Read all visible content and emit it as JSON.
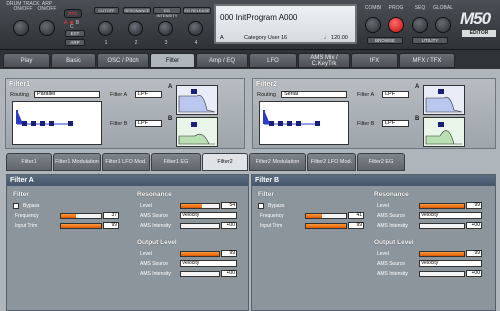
{
  "top": {
    "drum_track_label": "DRUM TRACK ON/OFF",
    "arp_label": "ARP ON/OFF",
    "rtc_label": "RTC",
    "abc_labels": [
      "A",
      "B",
      "C"
    ],
    "ext_label": "EXT",
    "arp_btn_label": "ARP",
    "knob_labels": [
      "CUTOFF",
      "RESONANCE",
      "EG INTENSITY",
      "EG RELEASE"
    ],
    "knob_numbers": [
      "1",
      "2",
      "3",
      "4"
    ],
    "combi_label": "COMBI",
    "prog_label": "PROG",
    "seq_label": "SEQ",
    "global_label": "GLOBAL",
    "browse_label": "BROWSE",
    "utility_label": "UTILITY",
    "logo": "M50",
    "logo_sub": "EDITOR"
  },
  "lcd": {
    "program": "000 InitProgram A000",
    "bank": "A",
    "category": "Category User 16",
    "tempo": "♩ 120.00"
  },
  "tabs": [
    "Play",
    "Basic",
    "OSC / Pitch",
    "Filter",
    "Amp / EQ",
    "LFO",
    "AMS Mix / C.KeyTrk",
    "IFX",
    "MFX / TFX"
  ],
  "active_tab": "Filter",
  "filter1": {
    "title": "Filter1",
    "routing_label": "Routing",
    "routing_value": "Parallel",
    "a_label": "Filter A",
    "a_type": "LPF",
    "b_label": "Filter B",
    "b_type": "LPF"
  },
  "filter2": {
    "title": "Filter2",
    "routing_label": "Routing",
    "routing_value": "Serial",
    "a_label": "Filter A",
    "a_type": "LPF",
    "b_label": "Filter B",
    "b_type": "LPF"
  },
  "subtabs": [
    "Filter1",
    "Filter1 Modulation",
    "Filter1 LFO Mod.",
    "Filter1 EG",
    "Filter2",
    "Filter2 Modulation",
    "Filter2 LFO Mod.",
    "Filter2 EG"
  ],
  "active_subtab": "Filter2",
  "filterA": {
    "title": "Filter A",
    "filter_label": "Filter",
    "bypass_label": "Bypass",
    "frequency_label": "Frequency",
    "frequency_value": "37",
    "frequency_frac": 0.37,
    "input_trim_label": "Input Trim",
    "input_trim_value": "99",
    "input_trim_frac": 0.99,
    "resonance_label": "Resonance",
    "res_level_label": "Level",
    "res_level_value": "54",
    "res_level_frac": 0.54,
    "res_ams_label": "AMS Source",
    "res_ams_value": "Velocity",
    "res_int_label": "AMS Intensity",
    "res_int_value": "+00",
    "output_label": "Output Level",
    "out_level_label": "Level",
    "out_level_value": "99",
    "out_level_frac": 0.99,
    "out_ams_label": "AMS Source",
    "out_ams_value": "Velocity",
    "out_int_label": "AMS Intensity",
    "out_int_value": "+00"
  },
  "filterB": {
    "title": "Filter B",
    "filter_label": "Filter",
    "bypass_label": "Bypass",
    "frequency_label": "Frequency",
    "frequency_value": "41",
    "frequency_frac": 0.41,
    "input_trim_label": "Input Trim",
    "input_trim_value": "99",
    "input_trim_frac": 0.99,
    "resonance_label": "Resonance",
    "res_level_label": "Level",
    "res_level_value": "99",
    "res_level_frac": 0.99,
    "res_ams_label": "AMS Source",
    "res_ams_value": "Velocity",
    "res_int_label": "AMS Intensity",
    "res_int_value": "+00",
    "output_label": "Output Level",
    "out_level_label": "Level",
    "out_level_value": "99",
    "out_level_frac": 0.99,
    "out_ams_label": "AMS Source",
    "out_ams_value": "Velocity",
    "out_int_label": "AMS Intensity",
    "out_int_value": "+00"
  },
  "colors": {
    "accent_orange": "#e86a10",
    "led_red": "#e02020",
    "panel": "#aeb5bb"
  }
}
